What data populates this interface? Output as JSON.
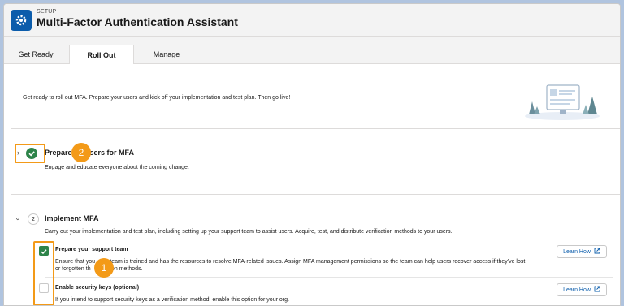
{
  "header": {
    "eyebrow": "SETUP",
    "title": "Multi-Factor Authentication Assistant",
    "icon": "gear-icon"
  },
  "tabs": [
    {
      "label": "Get Ready",
      "active": false
    },
    {
      "label": "Roll Out",
      "active": true
    },
    {
      "label": "Manage",
      "active": false
    }
  ],
  "intro": "Get ready to roll out MFA. Prepare your users and kick off your implementation and test plan. Then go live!",
  "sections": [
    {
      "title_visible": "Prepare",
      "title_visible_end": "sers for MFA",
      "subtitle": "Engage and educate everyone about the coming change.",
      "status": "complete",
      "expanded": false,
      "callout_number": "2"
    },
    {
      "step_number": "2",
      "title": "Implement MFA",
      "subtitle": "Carry out your implementation and test plan, including setting up your support team to assist users. Acquire, test, and distribute verification methods to your users.",
      "expanded": true,
      "callout_number": "1",
      "tasks": [
        {
          "title": "Prepare your support team",
          "desc_line1_start": "Ensure that you",
          "desc_line1_end": "r team is trained and has the resources to resolve MFA-related issues. Assign MFA management permissions so the team can help users recover access if they've lost",
          "desc_line2_start": "or forgotten th",
          "desc_line2_end": "ation methods.",
          "done": true,
          "button": "Learn How"
        },
        {
          "title": "Enable security keys (optional)",
          "desc_start": "If you intend to support security keys as a verification method, enable this option for your org.",
          "done": false,
          "button": "Learn How"
        }
      ]
    }
  ],
  "colors": {
    "brand": "#0b5cab",
    "success": "#2e844a",
    "callout": "#f39a18"
  }
}
